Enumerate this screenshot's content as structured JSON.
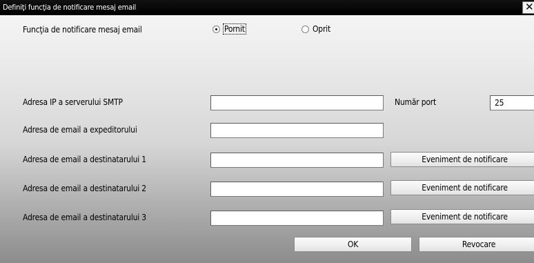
{
  "window": {
    "title": "Definiţi funcţia de notificare mesaj email"
  },
  "notification": {
    "label": "Funcţia de notificare mesaj email",
    "options": [
      {
        "label": "Pornit",
        "selected": true
      },
      {
        "label": "Oprit",
        "selected": false
      }
    ]
  },
  "smtp": {
    "label": "Adresa IP a serverului SMTP",
    "value": "",
    "port_label": "Număr port",
    "port_value": "25"
  },
  "sender": {
    "label": "Adresa de email a expeditorului",
    "value": ""
  },
  "recipients": [
    {
      "label": "Adresa de email a destinatarului 1",
      "value": "",
      "event_button": "Eveniment de notificare"
    },
    {
      "label": "Adresa de email a destinatarului 2",
      "value": "",
      "event_button": "Eveniment de notificare"
    },
    {
      "label": "Adresa de email a destinatarului 3",
      "value": "",
      "event_button": "Eveniment de notificare"
    }
  ],
  "buttons": {
    "ok": "OK",
    "cancel": "Revocare"
  },
  "icons": {
    "close": "close-icon"
  }
}
